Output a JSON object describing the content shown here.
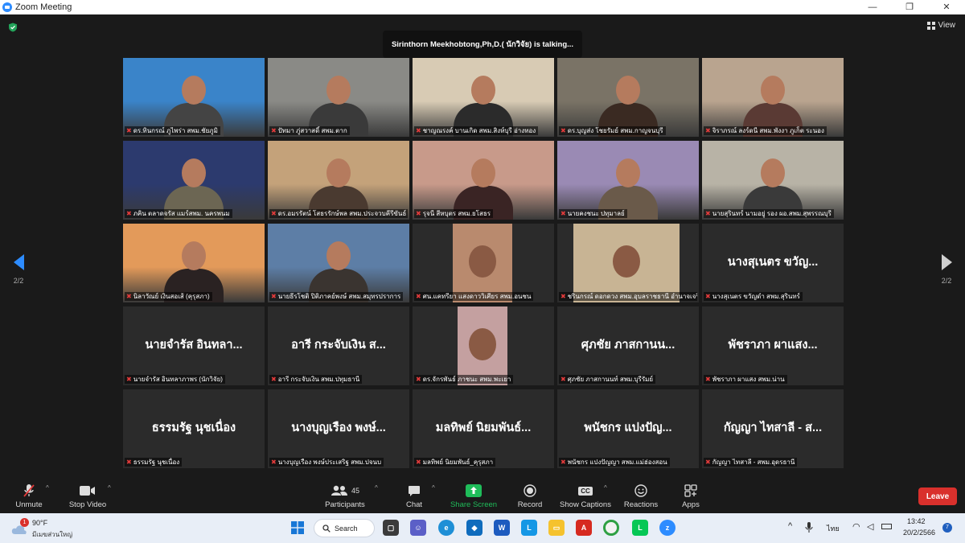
{
  "window": {
    "title": "Zoom Meeting",
    "min": "—",
    "max": "❐",
    "close": "✕"
  },
  "banner": {
    "talking": "Sirinthorn  Meekhobtong,Ph,D.( นักวิจัย)  is  talking..."
  },
  "view_label": "View",
  "page": {
    "left": "2/2",
    "right": "2/2"
  },
  "tiles": [
    {
      "caption": "ดร.ทินกรณ์ ภูไพร่า สพม.ชัยภูมิ",
      "bigname": "",
      "bg": "#3a84c9",
      "fg": "#444"
    },
    {
      "caption": "ปัทมา ภู่สวาสดิ์ สพม.ตาก",
      "bigname": "",
      "bg": "#8a8a86",
      "fg": "#3a3a3a"
    },
    {
      "caption": "ชาญณรงค์ บานเกิด สพม.สิงห์บุรี อ่างทอง",
      "bigname": "",
      "bg": "#d8cbb4",
      "fg": "#2b2b2b"
    },
    {
      "caption": "ดร.บุญส่ง โชยรัมย์ สพม.กาญจนบุรี",
      "bigname": "",
      "bg": "#7a7366",
      "fg": "#3a2a22"
    },
    {
      "caption": "จิราภรณ์ ลงร์ดนี สพม.พังงา ภูเก็ต ระนอง",
      "bigname": "",
      "bg": "#b9a48f",
      "fg": "#5a3a34"
    },
    {
      "caption": "ภคิน ตลาดจรัส แมร์สพม. นครพนม",
      "bigname": "",
      "bg": "#2c3a6e",
      "fg": "#6c6653"
    },
    {
      "caption": "ดร.อมรรัตน์ โสธรรักษ์พล สพม.ประจวบคีรีขันธ์",
      "bigname": "",
      "bg": "#c4a27a",
      "fg": "#4a3a30"
    },
    {
      "caption": "รุจนี สีหบุตร สพม.ยโสธร",
      "bigname": "",
      "bg": "#c89a8a",
      "fg": "#3a2424"
    },
    {
      "caption": "นายคงชนะ ปทุมาลย์",
      "bigname": "",
      "bg": "#9a8ab4",
      "fg": "#6a5a4a"
    },
    {
      "caption": "นายสุรินทร์ นามอยู่ รอง ผอ.สพม.สุพรรณบุรี",
      "bigname": "",
      "bg": "#b8b3a6",
      "fg": "#3a3a3a"
    },
    {
      "caption": "นิลาวัณย์ เงินสอเส้ (คุรุสภา)",
      "bigname": "",
      "bg": "#e39a5a",
      "fg": "#2a2222"
    },
    {
      "caption": "นายธีรโชติ ปิติภาคย์พงษ์ สพม.สมุทรปราการ",
      "bigname": "",
      "bg": "#5d7ea6",
      "fg": "#3a3430"
    },
    {
      "caption": "ศน.แคทรียา แสงดาววิเศียร สพม.อนชน",
      "bigname": "",
      "bg": "#2b2b2b",
      "fg": "#b98a6e"
    },
    {
      "caption": "ชรินกรณ์ ดอกดวง สพม.อุบลราชธานี อำนาจเจริญ",
      "bigname": "",
      "bg": "#2b2b2b",
      "fg": "#c8b494"
    },
    {
      "caption": "นางสุเนตร ขวัญดำ สพม.สุรินทร์",
      "bigname": "นางสุเนตร ขวัญ...",
      "bg": "#2b2b2b",
      "fg": "#2b2b2b"
    },
    {
      "caption": "นายจำรัส อินทลาภาพร (นักวิจัย)",
      "bigname": "นายจำรัส อินทลา...",
      "bg": "#2b2b2b",
      "fg": "#2b2b2b"
    },
    {
      "caption": "อารี กระจับเงิน สพม.ปทุมธานี",
      "bigname": "อารี กระจับเงิน ส...",
      "bg": "#2b2b2b",
      "fg": "#2b2b2b"
    },
    {
      "caption": "ดร.จักรพันธ์ ภาชนะ สพม.พะเยา",
      "bigname": "",
      "bg": "#2b2b2b",
      "fg": "#c4a0a0"
    },
    {
      "caption": "ศุภชัย ภาสกานนท์ สพม.บุรีรัมย์",
      "bigname": "ศุภชัย ภาสกานน...",
      "bg": "#2b2b2b",
      "fg": "#2b2b2b"
    },
    {
      "caption": "พัชราภา ผาแสง สพม.น่าน",
      "bigname": "พัชราภา ผาแสง...",
      "bg": "#2b2b2b",
      "fg": "#2b2b2b"
    },
    {
      "caption": "ธรรมรัฐ นุชเนื่อง",
      "bigname": "ธรรมรัฐ นุชเนื่อง",
      "bg": "#2b2b2b",
      "fg": "#2b2b2b"
    },
    {
      "caption": "นางบุญเรือง พงษ์ประเสริฐ สพม.ปจนบ",
      "bigname": "นางบุญเรือง พงษ์...",
      "bg": "#2b2b2b",
      "fg": "#2b2b2b"
    },
    {
      "caption": "มลทิพย์ นิยมพันธ์_คุรุสภา",
      "bigname": "มลทิพย์ นิยมพันธ์...",
      "bg": "#2b2b2b",
      "fg": "#2b2b2b"
    },
    {
      "caption": "พนัชกร แปงปัญญา สพม.แม่ฮ่องสอน",
      "bigname": "พนัชกร แปงปัญ...",
      "bg": "#2b2b2b",
      "fg": "#2b2b2b"
    },
    {
      "caption": "กัญญา ไทสาลี - สพม.อุดรธานี",
      "bigname": "กัญญา ไทสาลี - ส...",
      "bg": "#2b2b2b",
      "fg": "#2b2b2b"
    }
  ],
  "controls": {
    "unmute": "Unmute",
    "stop_video": "Stop Video",
    "participants": "Participants",
    "participants_count": "45",
    "chat": "Chat",
    "share": "Share Screen",
    "record": "Record",
    "captions": "Show Captions",
    "captions_icon": "CC",
    "reactions": "Reactions",
    "apps": "Apps",
    "leave": "Leave"
  },
  "taskbar": {
    "weather_temp": "90°F",
    "weather_desc": "มีเมฆส่วนใหญ่",
    "weather_badge": "1",
    "search": "Search",
    "lang": "ไทย",
    "time": "13:42",
    "date": "20/2/2566",
    "notif": "7"
  },
  "colors": {
    "accent": "#2d8cff",
    "leave": "#d9302c",
    "share": "#1fbd5a",
    "muted": "#e23b3b"
  }
}
